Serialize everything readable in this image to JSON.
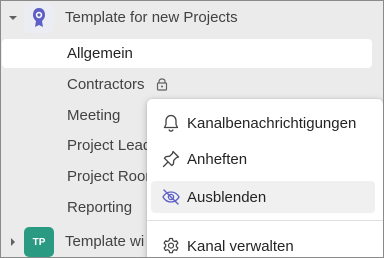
{
  "teams": [
    {
      "name": "Template for new Projects",
      "expanded": true
    },
    {
      "name": "Template wi",
      "initials": "TP",
      "expanded": false
    }
  ],
  "channels": [
    {
      "label": "Allgemein",
      "active": true
    },
    {
      "label": "Contractors",
      "locked": true
    },
    {
      "label": "Meeting"
    },
    {
      "label": "Project Lead"
    },
    {
      "label": "Project Room"
    },
    {
      "label": "Reporting"
    }
  ],
  "context_menu": {
    "items": [
      {
        "label": "Kanalbenachrichtigungen",
        "icon": "bell-icon"
      },
      {
        "label": "Anheften",
        "icon": "pin-icon"
      },
      {
        "label": "Ausblenden",
        "icon": "eye-off-icon",
        "hovered": true
      },
      {
        "label": "Kanal verwalten",
        "icon": "gear-icon"
      }
    ]
  },
  "colors": {
    "accent": "#5b5fc7",
    "team_tp": "#2b9a82"
  }
}
